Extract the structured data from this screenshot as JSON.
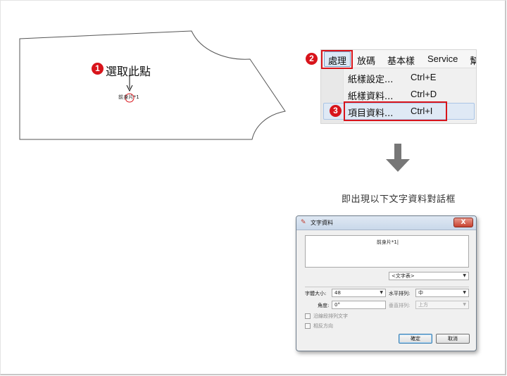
{
  "step1": {
    "number": "1",
    "label": "選取此點"
  },
  "pattern": {
    "piece_label": "前身片*1"
  },
  "step2": {
    "number": "2"
  },
  "step3": {
    "number": "3"
  },
  "menubar": {
    "items": [
      {
        "label": "處理"
      },
      {
        "label": "放碼"
      },
      {
        "label": "基本樣"
      },
      {
        "label": "Service"
      },
      {
        "label": "幫"
      }
    ]
  },
  "dropdown": {
    "items": [
      {
        "label": "紙樣設定...",
        "shortcut": "Ctrl+E"
      },
      {
        "label": "紙樣資料...",
        "shortcut": "Ctrl+D"
      },
      {
        "label": "項目資料...",
        "shortcut": "Ctrl+I"
      }
    ]
  },
  "caption": "即出現以下文字資料對話框",
  "dialog": {
    "title": "文字資料",
    "close": "X",
    "text_value": "前身片*1|",
    "text_table_select": "<文字表>",
    "font_size_label": "字體大小:",
    "font_size_value": "48",
    "h_align_label": "水平排列:",
    "h_align_value": "中",
    "angle_label": "角度:",
    "angle_value": "0°",
    "v_align_label": "垂直排列:",
    "v_align_value": "上方",
    "check_along_line": "沿線段排列文字",
    "check_reverse": "相反方向",
    "ok_label": "確定",
    "cancel_label": "取消"
  },
  "colors": {
    "step_red": "#d8141b",
    "highlight": "#dfe9f5"
  }
}
